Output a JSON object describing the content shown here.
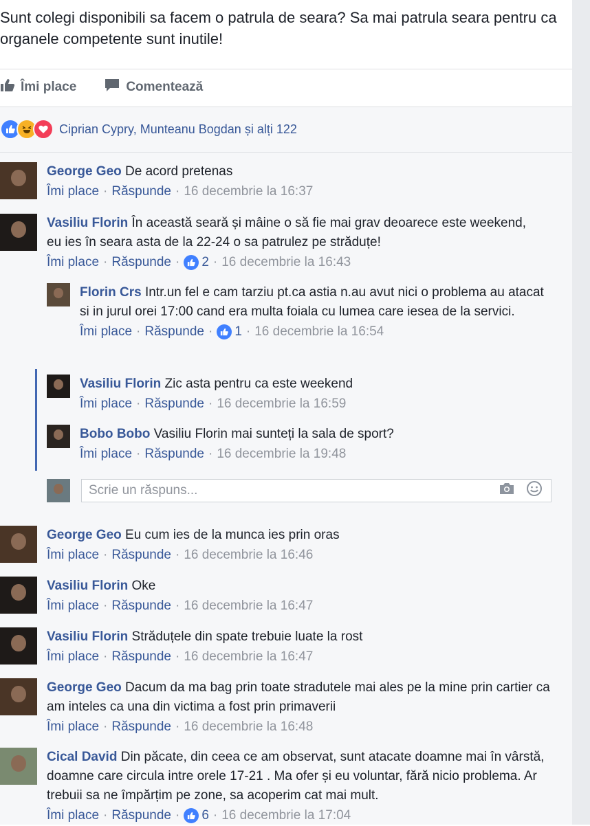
{
  "post": {
    "text": "Sunt colegi disponibili sa facem o patrula de seara? Sa mai patrula seara pentru ca organele competente sunt inutile!",
    "like_label": "Îmi place",
    "comment_label": "Comentează",
    "reactions_text": "Ciprian Cypry, Munteanu Bogdan și alți 122"
  },
  "meta_labels": {
    "like": "Îmi place",
    "reply": "Răspunde"
  },
  "comments": [
    {
      "author": "George Geo",
      "text": "De acord pretenas",
      "time": "16 decembrie la 16:37",
      "likes": ""
    },
    {
      "author": "Vasiliu Florin",
      "text": "În această seară și mâine o să fie mai grav deoarece este weekend, eu ies în seara asta de la 22-24 o sa patrulez pe străduțe!",
      "time": "16 decembrie la 16:43",
      "likes": "2"
    },
    {
      "author": "George Geo",
      "text": "Eu cum ies de la munca ies prin oras",
      "time": "16 decembrie la 16:46",
      "likes": ""
    },
    {
      "author": "Vasiliu Florin",
      "text": "Oke",
      "time": "16 decembrie la 16:47",
      "likes": ""
    },
    {
      "author": "Vasiliu Florin",
      "text": "Străduțele din spate trebuie luate la rost",
      "time": "16 decembrie la 16:47",
      "likes": ""
    },
    {
      "author": "George Geo",
      "text": "Dacum da ma bag prin toate stradutele mai ales pe la mine prin cartier ca am inteles ca una din victima a fost prin primaverii",
      "time": "16 decembrie la 16:48",
      "likes": ""
    },
    {
      "author": "Cical David",
      "text": "Din păcate, din ceea ce am observat, sunt atacate doamne mai în vârstă, doamne care circula intre orele 17-21 . Ma ofer și eu voluntar, fără nicio problema. Ar trebuii sa ne împărțim pe zone, sa acoperim cat mai mult.",
      "time": "16 decembrie la 17:04",
      "likes": "6"
    }
  ],
  "replies": [
    {
      "author": "Florin Crs",
      "text": "Intr.un fel e cam tarziu pt.ca astia n.au avut nici o problema au atacat si in jurul orei 17:00 cand era multa foiala cu lumea care iesea de la servici.",
      "time": "16 decembrie la 16:54",
      "likes": "1"
    },
    {
      "author": "Vasiliu Florin",
      "text": "Zic asta pentru ca este weekend",
      "time": "16 decembrie la 16:59",
      "likes": ""
    },
    {
      "author": "Bobo Bobo",
      "text": "Vasiliu Florin mai sunteți la sala de sport?",
      "time": "16 decembrie la 19:48",
      "likes": ""
    }
  ],
  "reply_input": {
    "placeholder": "Scrie un răspuns..."
  },
  "colors": {
    "link": "#385898",
    "like_blue": "#4080ff",
    "haha_yellow": "#f7b125",
    "love_red": "#f33e58"
  }
}
